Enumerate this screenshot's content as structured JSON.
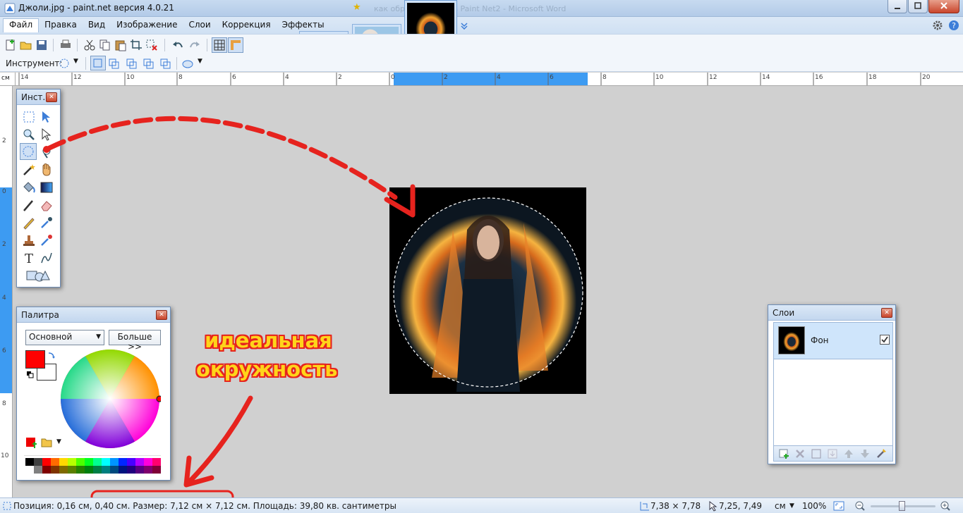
{
  "window": {
    "title": "Джоли.jpg - paint.net версия 4.0.21",
    "ghost_title": "как обрезать фото в Paint Net2 - Microsoft Word"
  },
  "menu": [
    "Файл",
    "Правка",
    "Вид",
    "Изображение",
    "Слои",
    "Коррекция",
    "Эффекты"
  ],
  "toolbar2": {
    "tool_label": "Инструмент:"
  },
  "ruler": {
    "unit": "см",
    "top_ticks": [
      "14",
      "12",
      "10",
      "8",
      "6",
      "4",
      "2",
      "0",
      "2",
      "4",
      "6",
      "8",
      "10",
      "12",
      "14",
      "16",
      "18",
      "20"
    ],
    "left_ticks": [
      "2",
      "0",
      "2",
      "4",
      "6",
      "8",
      "10"
    ]
  },
  "tools_panel": {
    "title": "Инст..."
  },
  "palette_panel": {
    "title": "Палитра",
    "mode_select": "Основной",
    "more_button": "Больше >>",
    "primary_color": "#ff0000"
  },
  "layers_panel": {
    "title": "Слои",
    "layers": [
      {
        "name": "Фон",
        "visible": true
      }
    ]
  },
  "annotation": {
    "line1": "идеальная",
    "line2": "окружность",
    "color": "#e6231e"
  },
  "status": {
    "selection_info": "Позиция: 0,16 см, 0,40 см. Размер: 7,12 см × 7,12 см. Площадь: 39,80 кв. сантиметры",
    "size": "7,38 × 7,78",
    "cursor": "7,25, 7,49",
    "unit": "см",
    "zoom": "100%"
  }
}
